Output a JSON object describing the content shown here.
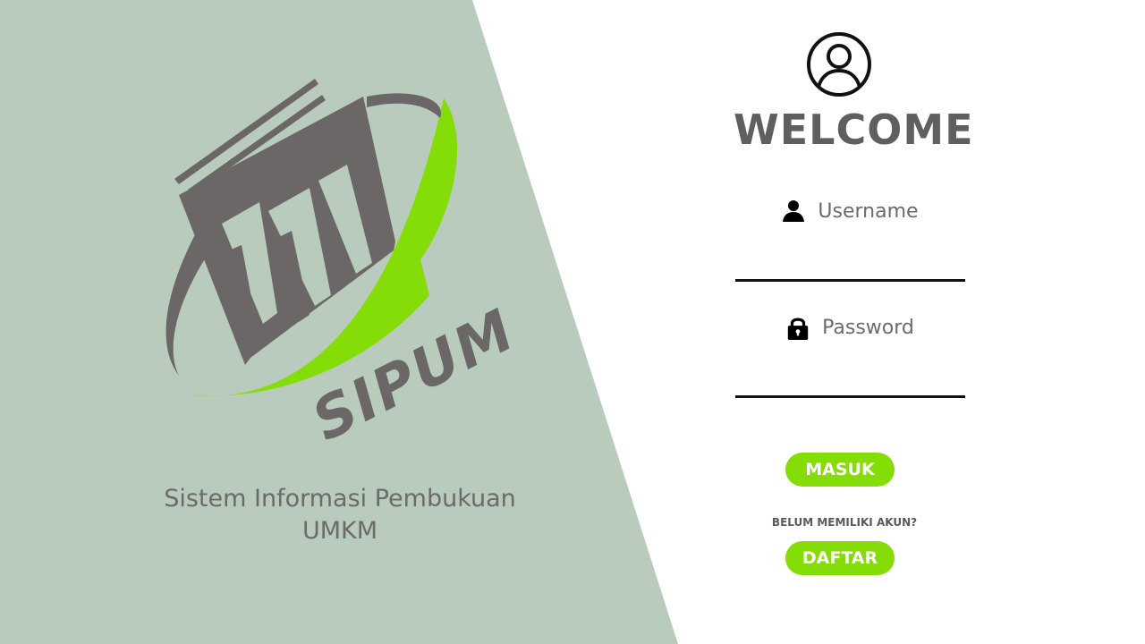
{
  "brand": {
    "logo_text": "SIPUM",
    "tagline_line1": "Sistem Informasi Pembukuan",
    "tagline_line2": "UMKM"
  },
  "login": {
    "title": "WELCOME",
    "username_placeholder": "Username",
    "password_placeholder": "Password",
    "login_button": "MASUK",
    "no_account_text": "BELUM MEMILIKI AKUN?",
    "register_button": "DAFTAR"
  },
  "icons": {
    "avatar": "user-circle-icon",
    "username": "user-icon",
    "password": "lock-icon"
  },
  "colors": {
    "left_panel": "#b8cbbc",
    "accent_green": "#84dd06",
    "logo_gray": "#6b6766",
    "text_gray": "#5f5f5f"
  }
}
